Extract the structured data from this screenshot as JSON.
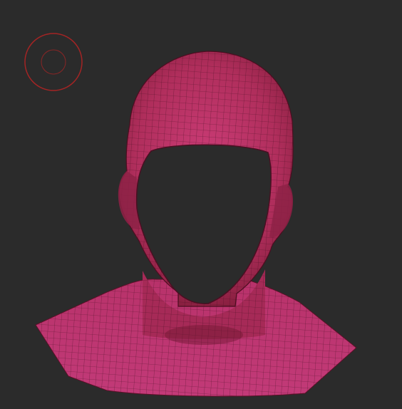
{
  "viewport": {
    "background_color": "#2b2b2b",
    "mesh_color": "#b6305f",
    "mesh_shadow_color": "#7d1a35",
    "wire_color": "#4a0f22",
    "brush_color": "#a42424"
  },
  "model": {
    "icon": "head-bust-mesh"
  },
  "brush": {
    "icon": "brush-cursor-circle"
  }
}
